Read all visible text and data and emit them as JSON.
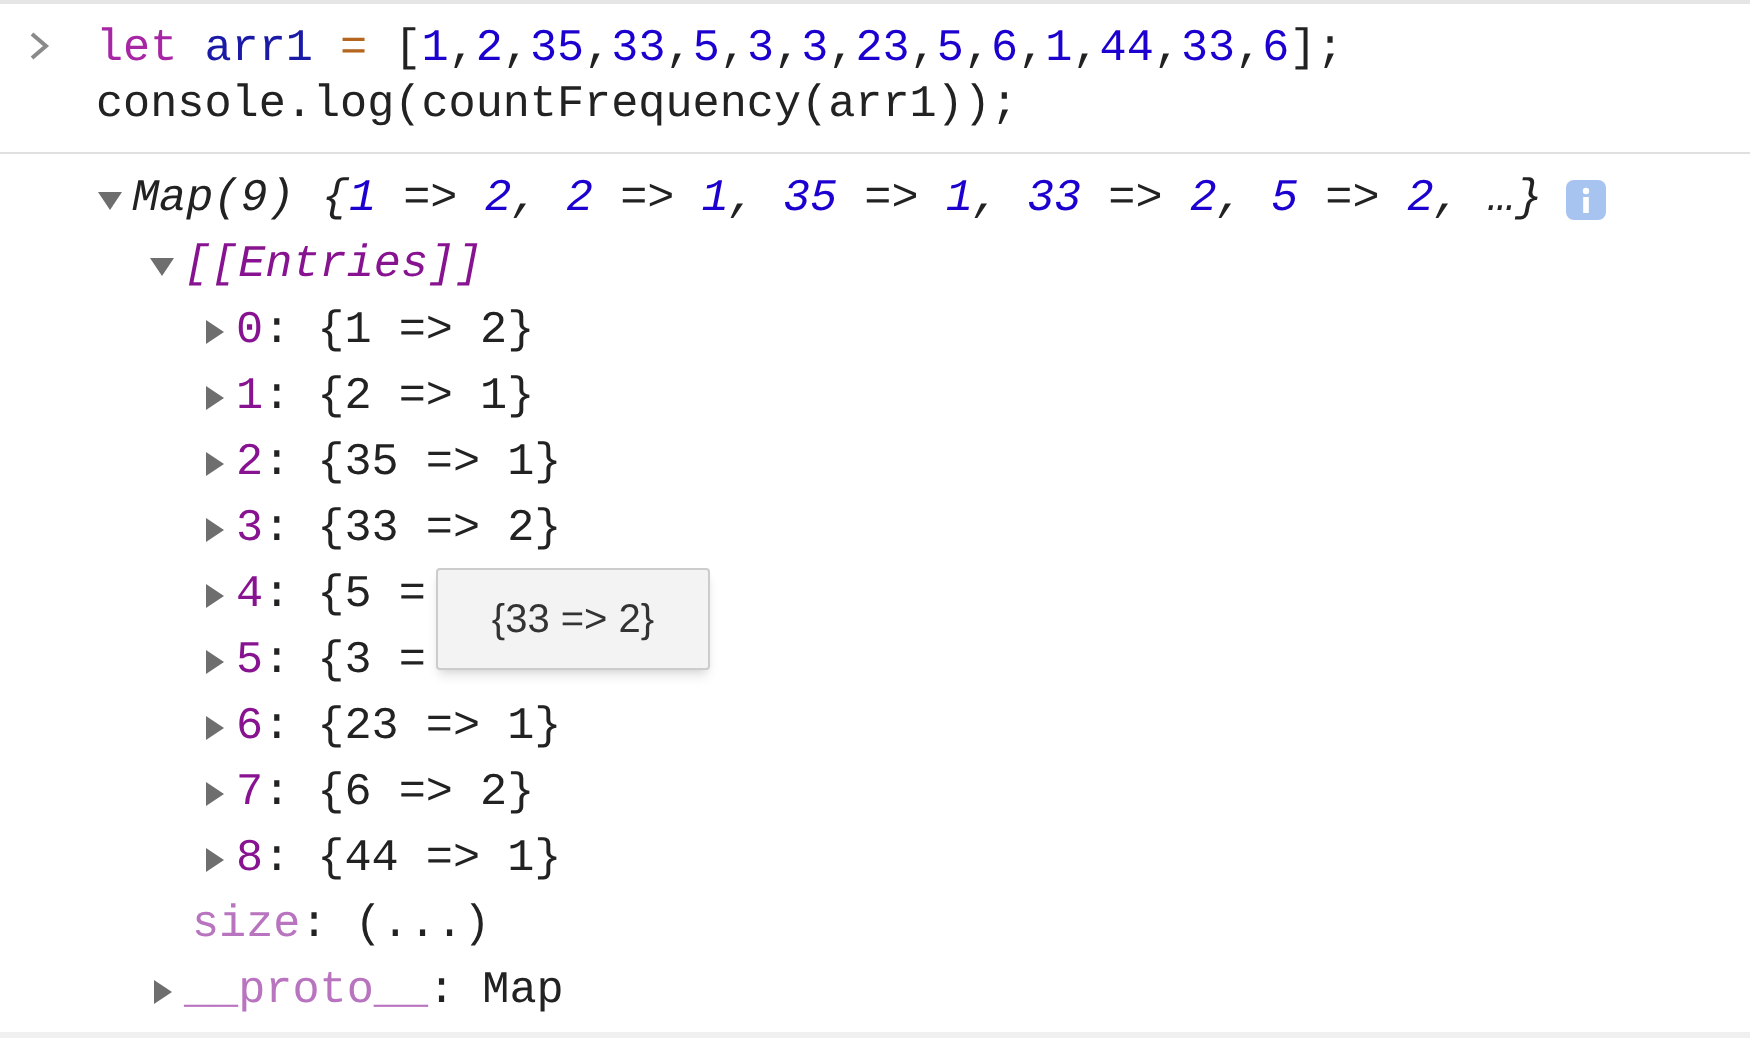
{
  "input": {
    "lines": [
      [
        {
          "kind": "keyword",
          "text": "let"
        },
        {
          "kind": "variable",
          "text": " arr1 "
        },
        {
          "kind": "operator",
          "text": "="
        },
        {
          "kind": "plain",
          "text": " ["
        },
        {
          "kind": "number",
          "text": "1"
        },
        {
          "kind": "plain",
          "text": ","
        },
        {
          "kind": "number",
          "text": "2"
        },
        {
          "kind": "plain",
          "text": ","
        },
        {
          "kind": "number",
          "text": "35"
        },
        {
          "kind": "plain",
          "text": ","
        },
        {
          "kind": "number",
          "text": "33"
        },
        {
          "kind": "plain",
          "text": ","
        },
        {
          "kind": "number",
          "text": "5"
        },
        {
          "kind": "plain",
          "text": ","
        },
        {
          "kind": "number",
          "text": "3"
        },
        {
          "kind": "plain",
          "text": ","
        },
        {
          "kind": "number",
          "text": "3"
        },
        {
          "kind": "plain",
          "text": ","
        },
        {
          "kind": "number",
          "text": "23"
        },
        {
          "kind": "plain",
          "text": ","
        },
        {
          "kind": "number",
          "text": "5"
        },
        {
          "kind": "plain",
          "text": ","
        },
        {
          "kind": "number",
          "text": "6"
        },
        {
          "kind": "plain",
          "text": ","
        },
        {
          "kind": "number",
          "text": "1"
        },
        {
          "kind": "plain",
          "text": ","
        },
        {
          "kind": "number",
          "text": "44"
        },
        {
          "kind": "plain",
          "text": ","
        },
        {
          "kind": "number",
          "text": "33"
        },
        {
          "kind": "plain",
          "text": ","
        },
        {
          "kind": "number",
          "text": "6"
        },
        {
          "kind": "plain",
          "text": "];"
        }
      ],
      [
        {
          "kind": "plain",
          "text": "console.log(countFrequency(arr1));"
        }
      ]
    ]
  },
  "output": {
    "label": "Map(9)",
    "expanded": true,
    "preview": [
      {
        "kind": "plain",
        "text": "{"
      },
      {
        "kind": "number",
        "text": "1"
      },
      {
        "kind": "plain",
        "text": " => "
      },
      {
        "kind": "number",
        "text": "2"
      },
      {
        "kind": "plain",
        "text": ", "
      },
      {
        "kind": "number",
        "text": "2"
      },
      {
        "kind": "plain",
        "text": " => "
      },
      {
        "kind": "number",
        "text": "1"
      },
      {
        "kind": "plain",
        "text": ", "
      },
      {
        "kind": "number",
        "text": "35"
      },
      {
        "kind": "plain",
        "text": " => "
      },
      {
        "kind": "number",
        "text": "1"
      },
      {
        "kind": "plain",
        "text": ", "
      },
      {
        "kind": "number",
        "text": "33"
      },
      {
        "kind": "plain",
        "text": " => "
      },
      {
        "kind": "number",
        "text": "2"
      },
      {
        "kind": "plain",
        "text": ", "
      },
      {
        "kind": "number",
        "text": "5"
      },
      {
        "kind": "plain",
        "text": " => "
      },
      {
        "kind": "number",
        "text": "2"
      },
      {
        "kind": "plain",
        "text": ", …}"
      }
    ],
    "entries": {
      "label": "[[Entries]]",
      "expanded": true,
      "items": [
        {
          "key": "0",
          "value": ": {1 => 2}",
          "expanded": false
        },
        {
          "key": "1",
          "value": ": {2 => 1}",
          "expanded": false
        },
        {
          "key": "2",
          "value": ": {35 => 1}",
          "expanded": false
        },
        {
          "key": "3",
          "value": ": {33 => 2}",
          "expanded": false
        },
        {
          "key": "4",
          "value": ": {5 =",
          "expanded": false
        },
        {
          "key": "5",
          "value": ": {3 =",
          "expanded": false
        },
        {
          "key": "6",
          "value": ": {23 => 1}",
          "expanded": false
        },
        {
          "key": "7",
          "value": ": {6 => 2}",
          "expanded": false
        },
        {
          "key": "8",
          "value": ": {44 => 1}",
          "expanded": false
        }
      ]
    },
    "size": {
      "key": "size",
      "value": ": (...)"
    },
    "proto": {
      "key": "__proto__",
      "value": ": Map",
      "expanded": false
    }
  },
  "tooltip": {
    "text": "{33 => 2}"
  }
}
